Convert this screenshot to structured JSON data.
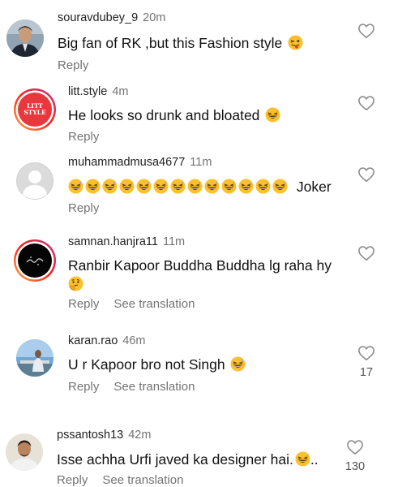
{
  "comments": [
    {
      "username": "souravdubey_9",
      "time": "20m",
      "text": "Big fan of RK ,but this Fashion style",
      "emoji": "wink-tongue-emoji",
      "reply": "Reply"
    },
    {
      "username": "litt.style",
      "time": "4m",
      "text": "He looks so drunk and bloated",
      "emoji": "laughing-sweat-emoji",
      "avatar_text": "LITT STYLE",
      "reply": "Reply"
    },
    {
      "username": "muhammadmusa4677",
      "time": "11m",
      "text": "Joker",
      "emoji": "laughing-sweat-emoji",
      "emoji_count": 13,
      "reply": "Reply"
    },
    {
      "username": "samnan.hanjra11",
      "time": "11m",
      "text": "Ranbir Kapoor Buddha Buddha lg raha hy",
      "emoji": "thinking-emoji",
      "reply": "Reply",
      "translate": "See translation"
    },
    {
      "username": "karan.rao",
      "time": "46m",
      "text": "U r Kapoor bro not Singh",
      "emoji": "laughing-sweat-emoji",
      "reply": "Reply",
      "translate": "See translation",
      "likes": "17"
    },
    {
      "username": "pssantosh13",
      "time": "42m",
      "text": "Isse achha Urfi javed ka designer hai.",
      "emoji": "laughing-sweat-emoji",
      "text_suffix": "..",
      "reply": "Reply",
      "translate": "See translation",
      "likes": "130"
    }
  ],
  "colors": {
    "meta": "#737373",
    "text": "#111111",
    "heart": "#8e8e8e"
  }
}
